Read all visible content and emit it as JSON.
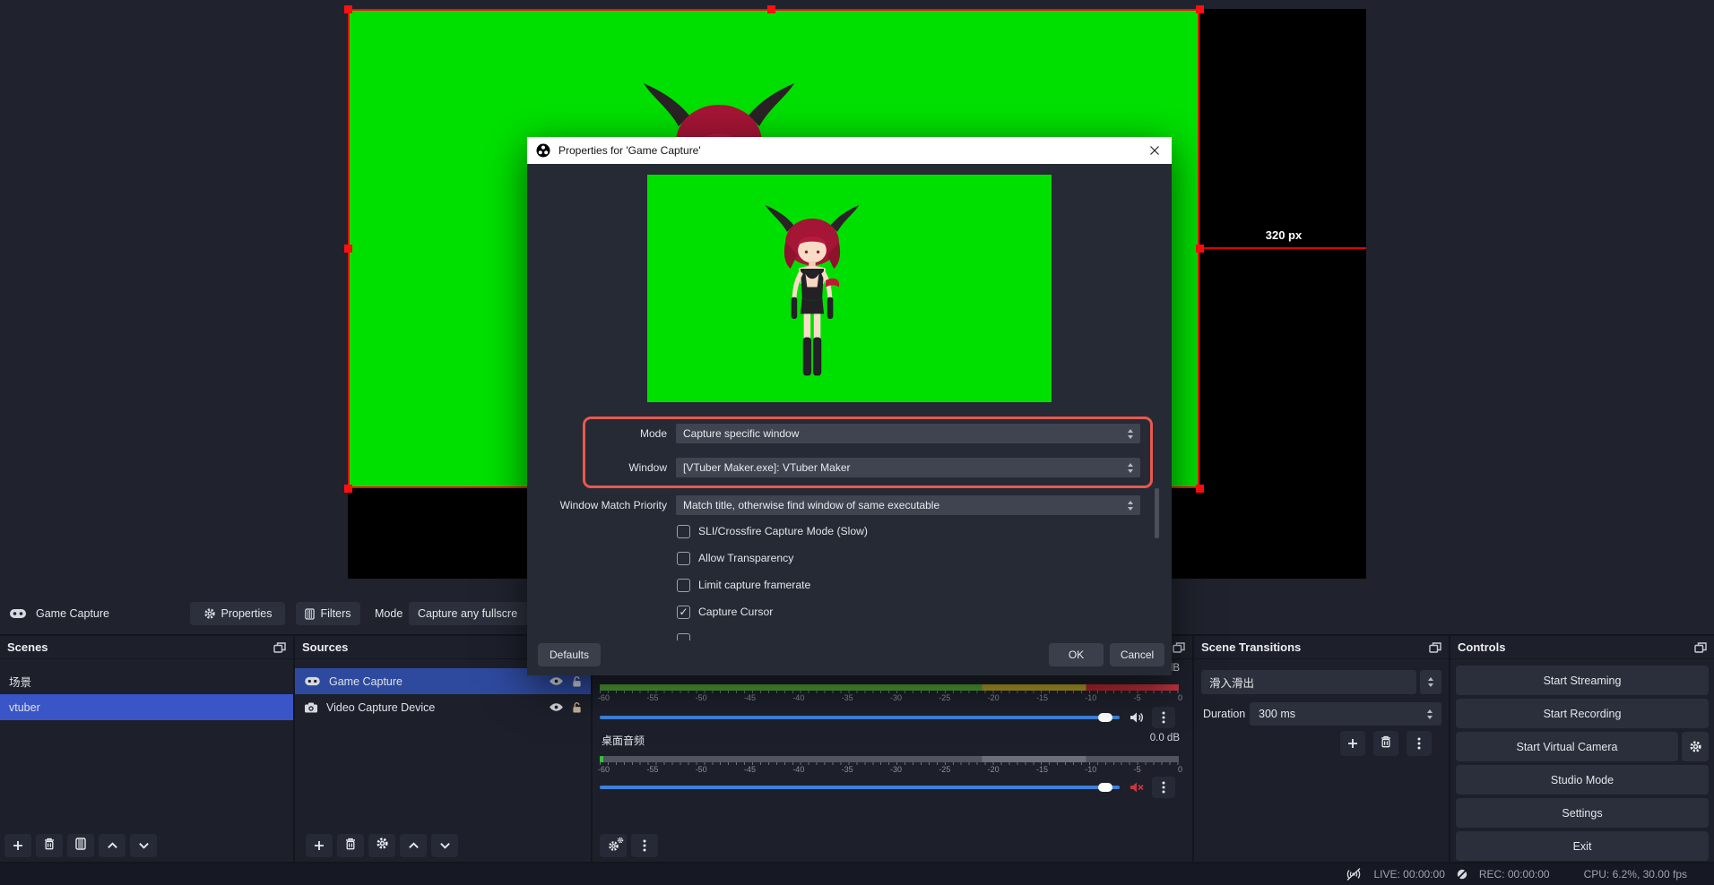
{
  "source_toolbar": {
    "source_name": "Game Capture",
    "properties_label": "Properties",
    "filters_label": "Filters",
    "mode_label": "Mode",
    "mode_value": "Capture any fullscre"
  },
  "preview": {
    "measure_label": "320 px"
  },
  "dialog": {
    "title": "Properties for 'Game Capture'",
    "mode_label": "Mode",
    "mode_value": "Capture specific window",
    "window_label": "Window",
    "window_value": "[VTuber Maker.exe]: VTuber Maker",
    "match_label": "Window Match Priority",
    "match_value": "Match title, otherwise find window of same executable",
    "checkboxes": [
      {
        "label": "SLI/Crossfire Capture Mode (Slow)",
        "checked": false
      },
      {
        "label": "Allow Transparency",
        "checked": false
      },
      {
        "label": "Limit capture framerate",
        "checked": false
      },
      {
        "label": "Capture Cursor",
        "checked": true
      }
    ],
    "check_glyph": "✓",
    "defaults_label": "Defaults",
    "ok_label": "OK",
    "cancel_label": "Cancel"
  },
  "scenes": {
    "title": "Scenes",
    "items": [
      {
        "label": "场景"
      },
      {
        "label": "vtuber"
      }
    ]
  },
  "sources": {
    "title": "Sources",
    "items": [
      {
        "label": "Game Capture"
      },
      {
        "label": "Video Capture Device"
      }
    ]
  },
  "mixer": {
    "meter1_db": "..: dB",
    "meter2_name": "桌面音频",
    "meter2_db": "0.0 dB",
    "ticks": [
      "-60",
      "-55",
      "-50",
      "-45",
      "-40",
      "-35",
      "-30",
      "-25",
      "-20",
      "-15",
      "-10",
      "-5",
      "0"
    ]
  },
  "transitions": {
    "title": "Scene Transitions",
    "transition_value": "滑入滑出",
    "duration_label": "Duration",
    "duration_value": "300 ms"
  },
  "controls": {
    "title": "Controls",
    "buttons": [
      "Start Streaming",
      "Start Recording",
      "Start Virtual Camera",
      "Studio Mode",
      "Settings",
      "Exit"
    ]
  },
  "statusbar": {
    "live": "LIVE: 00:00:00",
    "rec": "REC: 00:00:00",
    "cpu": "CPU: 6.2%, 30.00 fps"
  },
  "colors": {
    "annotation_red": "#e8584f",
    "selection_border_red": "#ff0f0f",
    "green_screen": "#00e000",
    "scene_selection_blue": "#3a55c8",
    "source_selection_blue": "#2e4a9e",
    "slider_blue": "#3e82dc"
  }
}
